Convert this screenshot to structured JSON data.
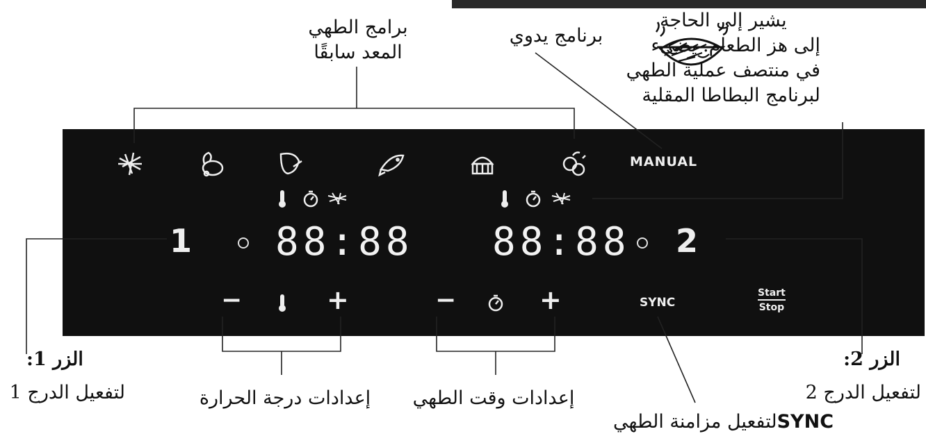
{
  "annotations": {
    "preset_programs_line1": "برامج الطهي",
    "preset_programs_line2": "المعد سابقًا",
    "manual_program": "برنامج يدوي",
    "shake_line1": "يشير إلى الحاجة",
    "shake_line2": "إلى هز الطعام. يضيء",
    "shake_line3": "في منتصف عملية الطهي",
    "shake_line4": "لبرنامج البطاطا المقلية",
    "button1_title": "الزر 1:",
    "button1_desc": "لتفعيل الدرج 1",
    "temp_settings": "إعدادات درجة الحرارة",
    "time_settings": "إعدادات وقت الطهي",
    "sync_desc_text": "لتفعيل مزامنة الطهي",
    "sync_desc_word": "SYNC",
    "button2_title": "الزر 2:",
    "button2_desc": "لتفعيل الدرج 2"
  },
  "panel": {
    "manual_label": "MANUAL",
    "drawer1_number": "1",
    "drawer2_number": "2",
    "display1": "88:88",
    "display2": "88:88",
    "minus": "−",
    "plus": "+",
    "sync_label": "SYNC",
    "start_label": "Start",
    "stop_label": "Stop"
  },
  "program_icons": [
    "fries-icon",
    "chicken-icon",
    "steak-icon",
    "fish-icon",
    "cake-icon",
    "vegetables-icon"
  ],
  "colors": {
    "panel": "#101010",
    "panel_text": "#efefef",
    "annotation": "#111111"
  }
}
